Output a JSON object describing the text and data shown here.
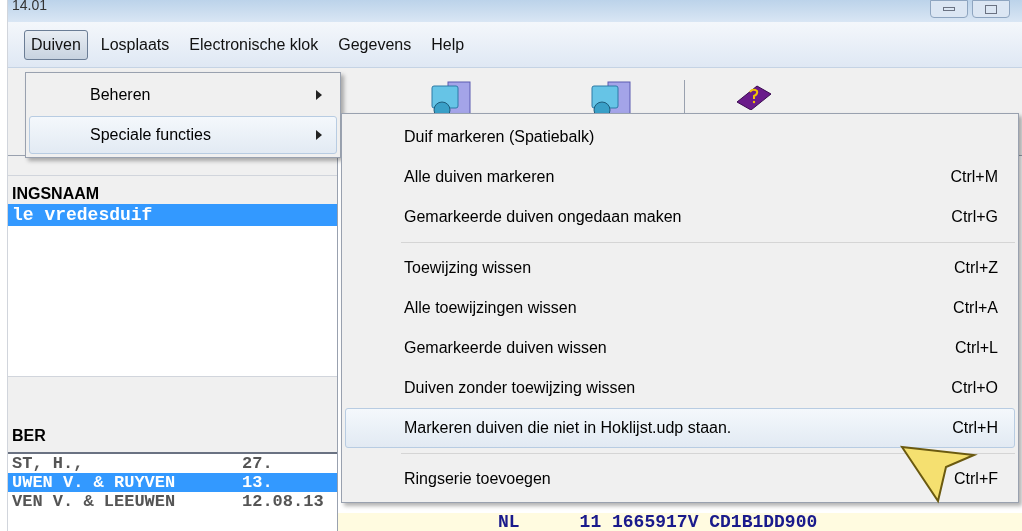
{
  "window": {
    "title": "14.01"
  },
  "menu_bar": [
    {
      "label": "Duiven",
      "selected": true
    },
    {
      "label": "Losplaats",
      "selected": false
    },
    {
      "label": "Electronische klok",
      "selected": false
    },
    {
      "label": "Gegevens",
      "selected": false
    },
    {
      "label": "Help",
      "selected": false
    }
  ],
  "duiven_menu": [
    {
      "label": "Beheren",
      "selected": false
    },
    {
      "label": "Speciale functies",
      "selected": true
    }
  ],
  "submenu_groups": [
    [
      {
        "label": "Duif markeren (Spatiebalk)",
        "selected": false
      },
      {
        "label": "Alle duiven markeren",
        "shortcut": "Ctrl+M",
        "selected": false
      },
      {
        "label": "Gemarkeerde duiven ongedaan maken",
        "shortcut": "Ctrl+G",
        "selected": false
      }
    ],
    [
      {
        "label": "Toewijzing wissen",
        "shortcut": "Ctrl+Z",
        "selected": false
      },
      {
        "label": "Alle toewijzingen wissen",
        "shortcut": "Ctrl+A",
        "selected": false
      },
      {
        "label": "Gemarkeerde duiven wissen",
        "shortcut": "Ctrl+L",
        "selected": false
      },
      {
        "label": "Duiven zonder toewijzing wissen",
        "shortcut": "Ctrl+O",
        "selected": false
      },
      {
        "label": "Markeren duiven die niet in Hoklijst.udp staan.",
        "shortcut": "Ctrl+H",
        "selected": true
      }
    ],
    [
      {
        "label": "Ringserie toevoegen",
        "shortcut": "Ctrl+F",
        "selected": false
      }
    ]
  ],
  "list_top": {
    "header": "INGSNAAM",
    "rows": [
      {
        "name": "le vredesduif",
        "selected": true
      }
    ]
  },
  "list_bottom": {
    "header": "BER",
    "rows": [
      {
        "name": "ST, H.,",
        "date": "27.",
        "selected": false
      },
      {
        "name": "UWEN V. & RUYVEN",
        "date": "13.",
        "selected": true
      },
      {
        "name": "VEN V. & LEEUWEN",
        "date": "12.08.13",
        "selected": false
      }
    ]
  },
  "record": {
    "country": "NL",
    "number": "11 1665917V CD1B1DD900"
  }
}
